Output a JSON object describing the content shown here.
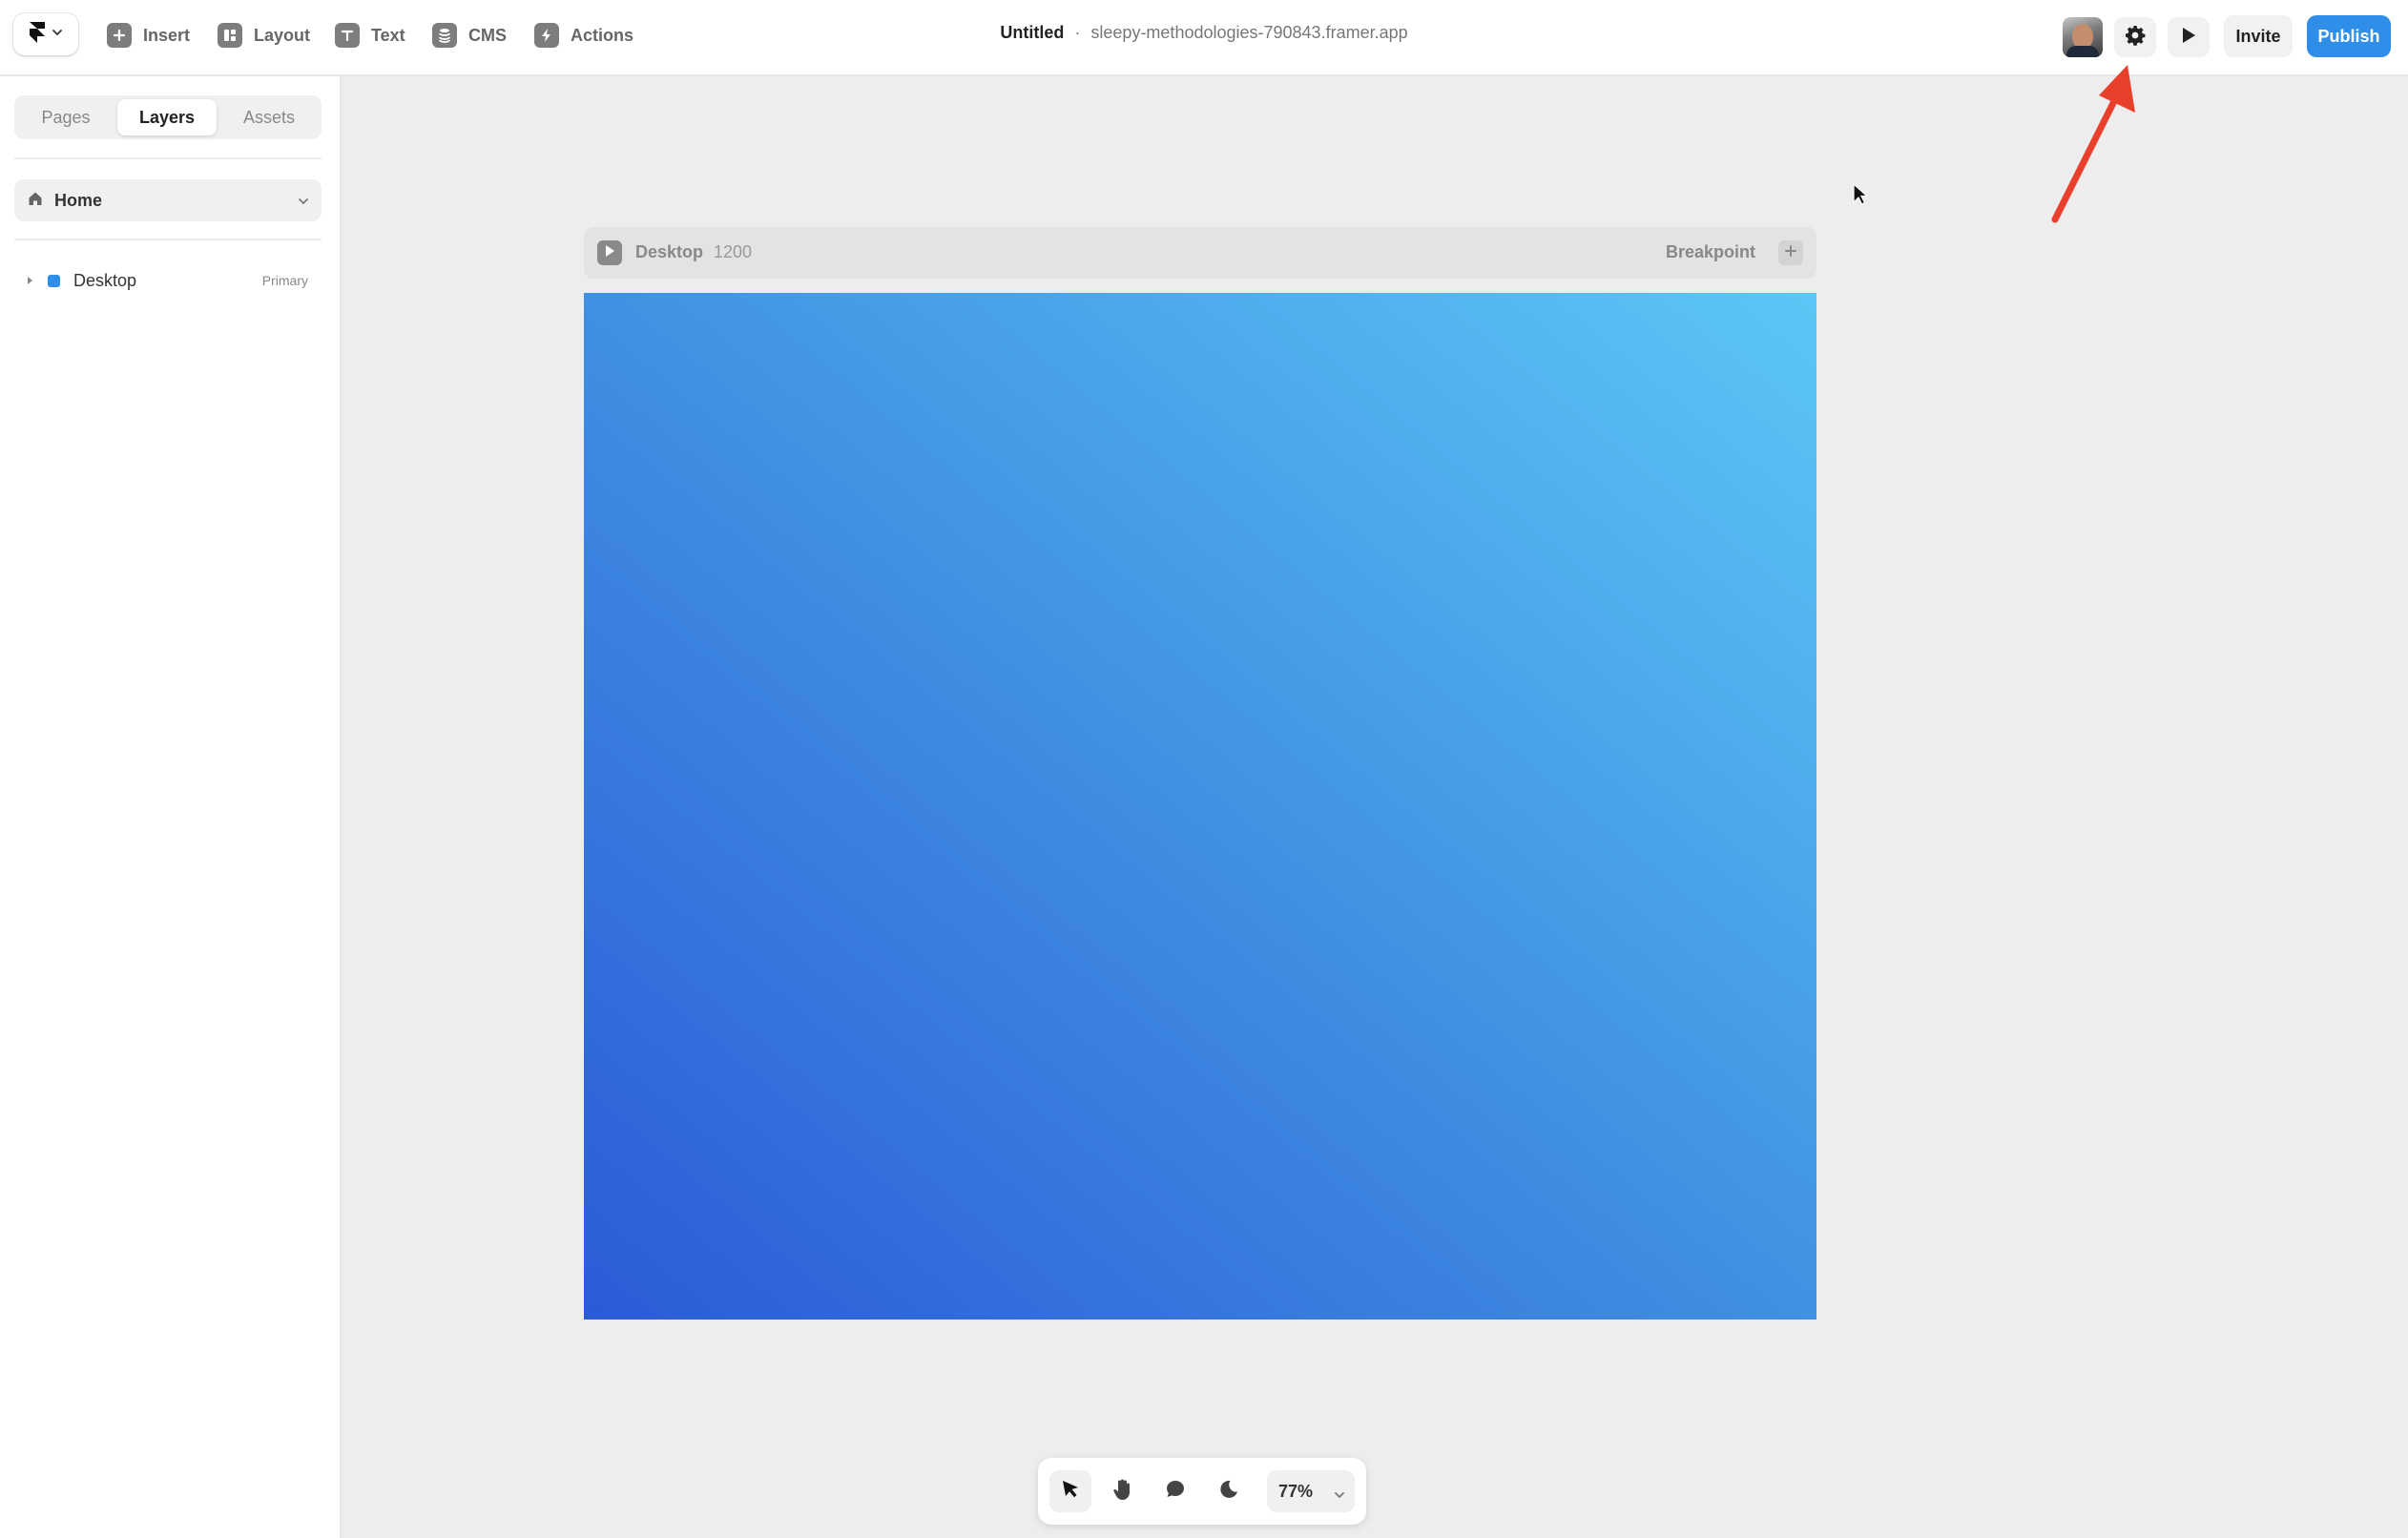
{
  "toolbar": {
    "menu_icon": "framer-logo-icon",
    "tools": [
      {
        "label": "Insert",
        "icon": "plus-icon"
      },
      {
        "label": "Layout",
        "icon": "layout-icon"
      },
      {
        "label": "Text",
        "icon": "text-icon"
      },
      {
        "label": "CMS",
        "icon": "database-icon"
      },
      {
        "label": "Actions",
        "icon": "lightning-icon"
      }
    ],
    "doc_name": "Untitled",
    "separator": "·",
    "doc_domain": "sleepy-methodologies-790843.framer.app",
    "settings_icon": "gear-icon",
    "preview_icon": "play-icon",
    "invite_label": "Invite",
    "publish_label": "Publish"
  },
  "sidebar": {
    "tabs": [
      {
        "label": "Pages",
        "active": false
      },
      {
        "label": "Layers",
        "active": true
      },
      {
        "label": "Assets",
        "active": false
      }
    ],
    "page_selector": {
      "label": "Home",
      "icon": "home-icon"
    },
    "layers": [
      {
        "name": "Desktop",
        "badge": "Primary",
        "color": "#2f8fe8"
      }
    ]
  },
  "canvas": {
    "frame": {
      "name": "Desktop",
      "width": "1200",
      "breakpoint_label": "Breakpoint",
      "gradient": [
        "#2a5bd7",
        "#4190e3",
        "#5bc7f5"
      ]
    }
  },
  "bottom_toolbar": {
    "tools": [
      "pointer-icon",
      "hand-icon",
      "comment-icon",
      "moon-icon"
    ],
    "zoom": "77%"
  },
  "colors": {
    "accent": "#2f8fe8",
    "annotation": "#e8402b"
  }
}
